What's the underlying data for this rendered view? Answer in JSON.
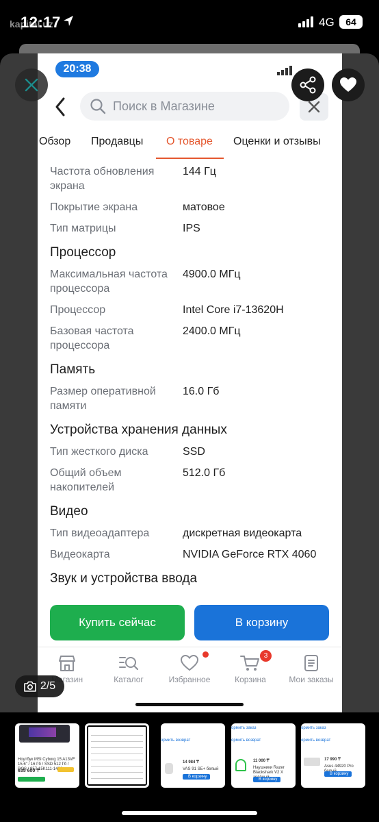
{
  "os_status": {
    "time": "12:17",
    "watermark": "kapital.uz",
    "network": "4G",
    "battery": "64"
  },
  "inner_status": {
    "time": "20:38"
  },
  "search": {
    "placeholder": "Поиск в Магазине"
  },
  "tabs": [
    {
      "label": "Обзор",
      "active": false
    },
    {
      "label": "Продавцы",
      "active": false
    },
    {
      "label": "О товаре",
      "active": true
    },
    {
      "label": "Оценки и отзывы",
      "active": false
    }
  ],
  "specs": {
    "display_rows": [
      {
        "key": "Частота обновления экрана",
        "value": "144 Гц"
      },
      {
        "key": "Покрытие экрана",
        "value": "матовое"
      },
      {
        "key": "Тип матрицы",
        "value": "IPS"
      }
    ],
    "cpu_title": "Процессор",
    "cpu_rows": [
      {
        "key": "Максимальная частота процессора",
        "value": "4900.0 МГц"
      },
      {
        "key": "Процессор",
        "value": "Intel Core i7-13620H"
      },
      {
        "key": "Базовая частота процессора",
        "value": "2400.0 МГц"
      }
    ],
    "memory_title": "Память",
    "memory_rows": [
      {
        "key": "Размер оперативной памяти",
        "value": "16.0 Гб"
      }
    ],
    "storage_title": "Устройства хранения данных",
    "storage_rows": [
      {
        "key": "Тип жесткого диска",
        "value": "SSD"
      },
      {
        "key": "Общий объем накопителей",
        "value": "512.0 Гб"
      }
    ],
    "video_title": "Видео",
    "video_rows": [
      {
        "key": "Тип видеоадаптера",
        "value": "дискретная видеокарта"
      },
      {
        "key": "Видеокарта",
        "value": "NVIDIA GeForce RTX 4060"
      }
    ],
    "sound_title": "Звук и устройства ввода"
  },
  "actions": {
    "buy_label": "Купить сейчас",
    "cart_label": "В корзину"
  },
  "bottom_nav": {
    "store": "Магазин",
    "catalog": "Каталог",
    "favorites": "Избранное",
    "cart": "Корзина",
    "cart_badge": "3",
    "orders": "Мои заказы"
  },
  "viewer": {
    "counter": "2/5"
  },
  "thumbnails": {
    "t1_price": "635 600 ₸",
    "t1_desc": "Ноутбук MSI Cyborg 15 A13VF 15.6\" / 16 Гб / SSD 512 Гб / DOS / 957-15K111-1426",
    "t3_action": "ормить возврат",
    "t3_price": "14 984 ₸",
    "t3_desc": "VAS 91 SE+ белый",
    "t3_btn": "В корзину",
    "t4_top": "ормить заказ",
    "t4_action": "ормить возврат",
    "t4_price": "11 000 ₸",
    "t4_desc": "Наушники Razer Blackshark V2 X зелёный",
    "t4_btn": "В корзину",
    "t5_top": "ормить заказ",
    "t5_action": "ормить возврат",
    "t5_price": "17 990 ₸",
    "t5_desc": "Asus 44920 Pro белый",
    "t5_btn": "В корзину"
  },
  "colors": {
    "accent_tab": "#e4572e",
    "buy_green": "#1eae4e",
    "cart_blue": "#1a73d9",
    "badge_red": "#e8392c"
  }
}
